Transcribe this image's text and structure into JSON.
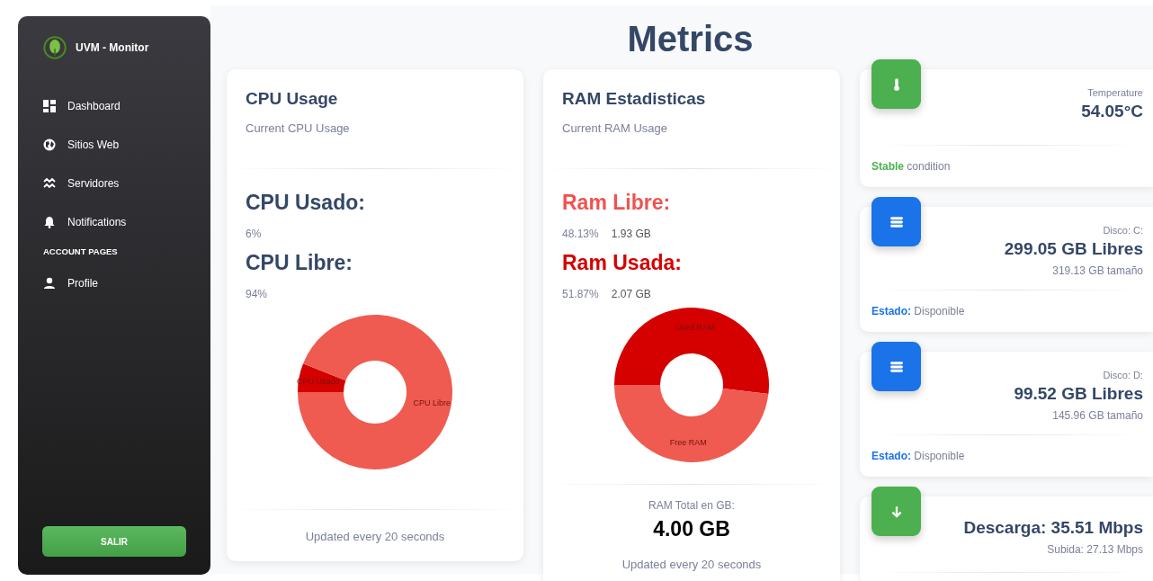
{
  "sidebar": {
    "brand": "UVM - Monitor",
    "items": [
      {
        "label": "Dashboard"
      },
      {
        "label": "Sitios Web"
      },
      {
        "label": "Servidores"
      },
      {
        "label": "Notifications"
      }
    ],
    "section_heading": "ACCOUNT PAGES",
    "account_items": [
      {
        "label": "Profile"
      }
    ],
    "logout_button": "SALIR"
  },
  "page_title": "Metrics",
  "panels": [
    {
      "title": "CPU Usage",
      "subtitle": "Current CPU Usage",
      "stats": [
        {
          "label": "CPU Usado:",
          "percent": "6%",
          "color": "#344767"
        },
        {
          "label": "CPU Libre:",
          "percent": "94%",
          "color": "#344767"
        }
      ],
      "chart_data": {
        "type": "donut",
        "categories": [
          "CPU Usado",
          "CPU Libre"
        ],
        "values": [
          6,
          94
        ]
      },
      "footer": "Updated every 20 seconds"
    },
    {
      "title": "RAM Estadisticas",
      "subtitle": "Current RAM Usage",
      "stats": [
        {
          "label": "Ram Libre:",
          "percent": "48.13%",
          "amount": "1.93 GB",
          "color": "#ef5350"
        },
        {
          "label": "Ram Usada:",
          "percent": "51.87%",
          "amount": "2.07 GB",
          "color": "#d50000"
        }
      ],
      "chart_data": {
        "type": "donut",
        "categories": [
          "Used RAM",
          "Free RAM"
        ],
        "values": [
          51.87,
          48.13
        ]
      },
      "total_label": "RAM Total en GB:",
      "total_value": "4.00 GB",
      "footer": "Updated every 20 seconds"
    }
  ],
  "stat_cards": [
    {
      "label": "Temperature",
      "value": "54.05°C",
      "footer": "**Stable** condition",
      "color": "#4caf50"
    },
    {
      "label": "Disco: C:",
      "value": "299.05 GB Libres",
      "sub": "319.13 GB tamaño",
      "footer": "**Estado:** Disponible",
      "color": "#1a73e8"
    },
    {
      "label": "Disco: D:",
      "value": "99.52 GB Libres",
      "sub": "145.96 GB tamaño",
      "footer": "**Estado:** Disponible",
      "color": "#1a73e8"
    },
    {
      "value": "Descarga: 35.51 Mbps",
      "sub": "Subida: 27.13 Mbps",
      "color": "#4caf50"
    }
  ]
}
